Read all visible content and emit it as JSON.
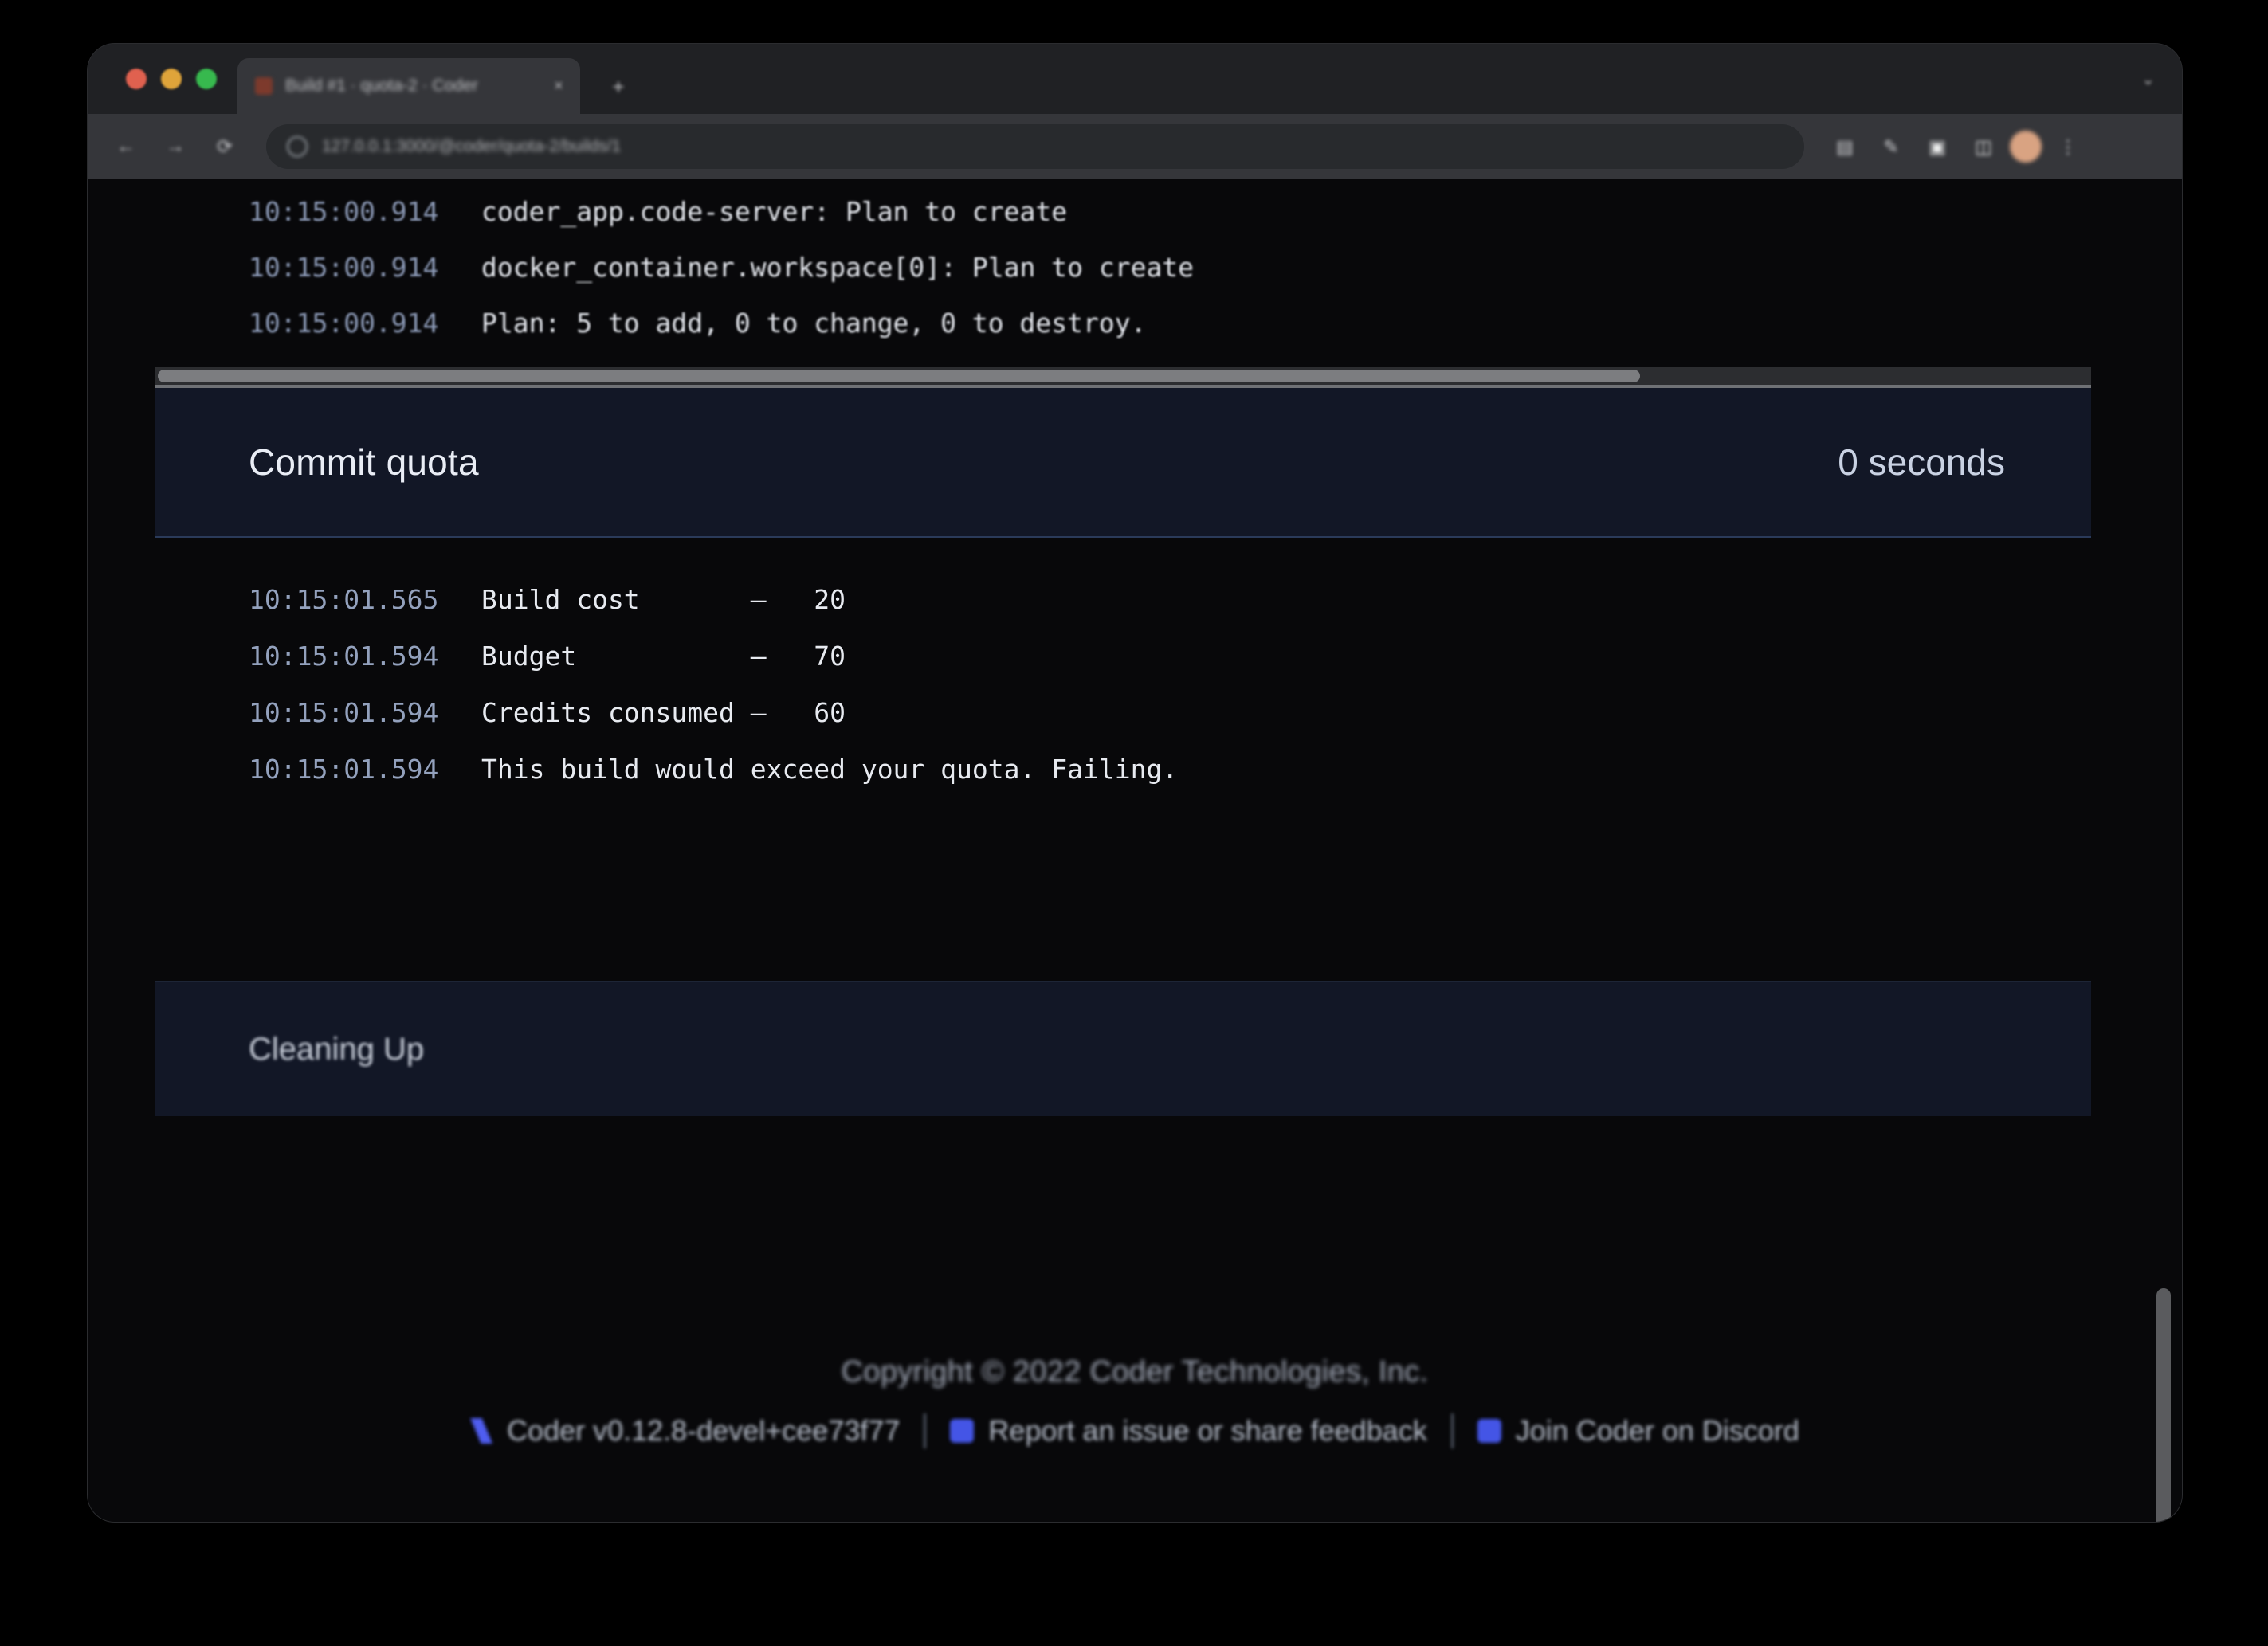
{
  "browser": {
    "tab": {
      "title": "Build #1 · quota-2 · Coder",
      "close_label": "×",
      "favicon_name": "coder-favicon"
    },
    "new_tab_label": "+",
    "tabstrip_chevron": "⌄",
    "nav": {
      "back": "←",
      "forward": "→",
      "reload": "⟳"
    },
    "omnibox": {
      "url": "127.0.0.1:3000/@coder/quota-2/builds/1",
      "lock_name": "site-info-icon"
    },
    "toolbar_icons": [
      "search-icon",
      "bookmark-icon",
      "share-icon",
      "reader-icon",
      "pencil-icon",
      "extension-icon",
      "sidepanel-icon",
      "profile-avatar",
      "overflow-menu-icon"
    ]
  },
  "scrolled_log": {
    "lines": [
      {
        "time": "10:15:00.914",
        "message": "coder_app.code-server: Plan to create"
      },
      {
        "time": "10:15:00.914",
        "message": "docker_container.workspace[0]: Plan to create"
      },
      {
        "time": "10:15:00.914",
        "message": "Plan: 5 to add, 0 to change, 0 to destroy."
      }
    ]
  },
  "stage": {
    "title": "Commit quota",
    "duration": "0 seconds",
    "lines": [
      {
        "time": "10:15:01.565",
        "message": "Build cost       —   20"
      },
      {
        "time": "10:15:01.594",
        "message": "Budget           —   70"
      },
      {
        "time": "10:15:01.594",
        "message": "Credits consumed —   60"
      },
      {
        "time": "10:15:01.594",
        "message": "This build would exceed your quota. Failing."
      }
    ]
  },
  "cleanup_stage": {
    "title": "Cleaning Up"
  },
  "footer": {
    "copyright": "Copyright © 2022 Coder Technologies, Inc.",
    "links": [
      {
        "label": "Coder v0.12.8-devel+cee73f77",
        "icon": "coder-logo-icon"
      },
      {
        "label": "Report an issue or share feedback",
        "icon": "github-icon"
      },
      {
        "label": "Join Coder on Discord",
        "icon": "discord-icon"
      }
    ],
    "separator": "|"
  },
  "colors": {
    "page_background": "#08080A",
    "stage_header_background": "#121726",
    "stage_header_border": "#2a3a59",
    "timestamp": "#93a1bd",
    "log_text": "#e7eaf0",
    "brand_accent": "#4455e6"
  }
}
